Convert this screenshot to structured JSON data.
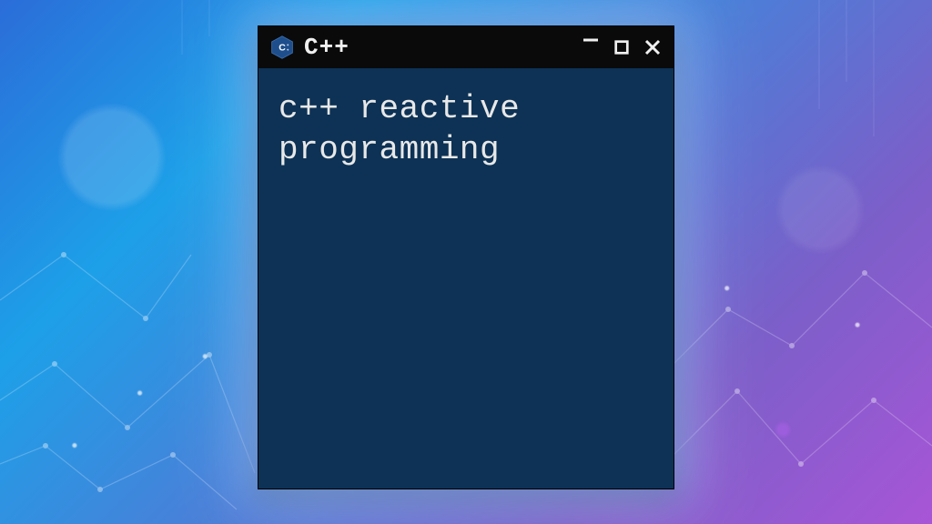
{
  "window": {
    "title": "C++",
    "icon_name": "cpp-logo-icon",
    "controls": {
      "minimize_name": "minimize-icon",
      "maximize_name": "maximize-icon",
      "close_name": "close-icon"
    }
  },
  "terminal": {
    "content": "c++ reactive programming"
  },
  "colors": {
    "window_bg": "#0d3255",
    "titlebar_bg": "#0a0a0a",
    "text": "#e8e8e8"
  }
}
